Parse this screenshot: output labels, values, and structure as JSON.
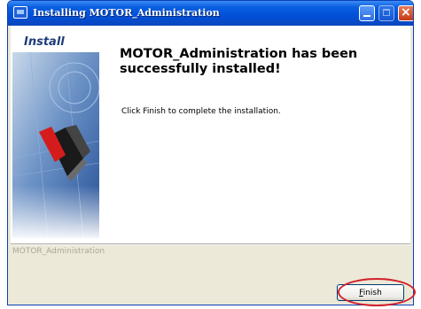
{
  "window": {
    "title": "Installing MOTOR_Administration"
  },
  "sidebar": {
    "label": "Install"
  },
  "main": {
    "heading": "MOTOR_Administration has been successfully installed!",
    "description": "Click Finish to complete the installation."
  },
  "footer": {
    "brand": "MOTOR_Administration",
    "finish_label": "Finish"
  },
  "colors": {
    "titlebar": "#0054e3",
    "highlight": "#d2202a",
    "dialog_bg": "#ece9d8"
  },
  "icons": {
    "app": "installer-icon",
    "minimize": "minimize-icon",
    "maximize": "maximize-icon",
    "close": "close-icon"
  }
}
